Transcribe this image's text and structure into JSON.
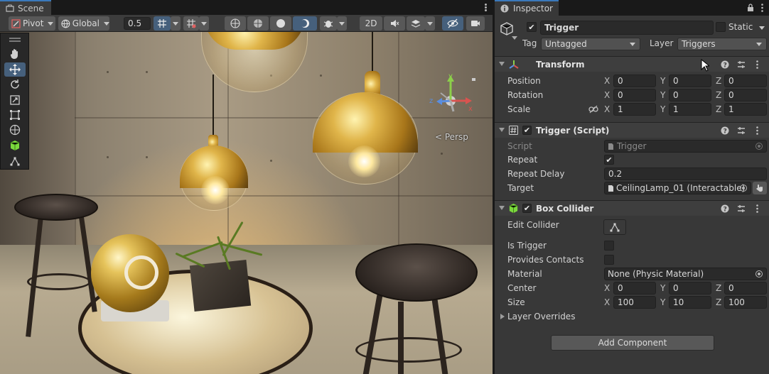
{
  "scene": {
    "tab_label": "Scene",
    "pivot_label": "Pivot",
    "global_label": "Global",
    "snap_value": "0.5",
    "mode_2d_label": "2D",
    "persp_label": "< Persp",
    "gizmo_axes": {
      "x": "x",
      "y": "y",
      "z": "z"
    }
  },
  "inspector": {
    "tab_label": "Inspector",
    "object": {
      "name": "Trigger",
      "active": true,
      "static_label": "Static",
      "static": false,
      "tag_label": "Tag",
      "tag_value": "Untagged",
      "layer_label": "Layer",
      "layer_value": "Triggers"
    },
    "transform": {
      "title": "Transform",
      "position_label": "Position",
      "rotation_label": "Rotation",
      "scale_label": "Scale",
      "position": {
        "x": "0",
        "y": "0",
        "z": "0"
      },
      "rotation": {
        "x": "0",
        "y": "0",
        "z": "0"
      },
      "scale": {
        "x": "1",
        "y": "1",
        "z": "1"
      }
    },
    "trigger_script": {
      "title": "Trigger (Script)",
      "enabled": true,
      "script_label": "Script",
      "script_value": "Trigger",
      "repeat_label": "Repeat",
      "repeat": true,
      "repeat_delay_label": "Repeat Delay",
      "repeat_delay_value": "0.2",
      "target_label": "Target",
      "target_value": "CeilingLamp_01 (Interactable)"
    },
    "box_collider": {
      "title": "Box Collider",
      "enabled": true,
      "edit_collider_label": "Edit Collider",
      "is_trigger_label": "Is Trigger",
      "is_trigger": false,
      "provides_contacts_label": "Provides Contacts",
      "provides_contacts": false,
      "material_label": "Material",
      "material_value": "None (Physic Material)",
      "center_label": "Center",
      "center": {
        "x": "0",
        "y": "0",
        "z": "0"
      },
      "size_label": "Size",
      "size": {
        "x": "100",
        "y": "10",
        "z": "100"
      },
      "layer_overrides_label": "Layer Overrides"
    },
    "add_component_label": "Add Component",
    "axis_labels": {
      "x": "X",
      "y": "Y",
      "z": "Z"
    }
  },
  "colors": {
    "accent_blue": "#3a79bb",
    "active_tool": "#46607c",
    "panel_bg": "#383838",
    "header_bg": "#3e3e3e"
  }
}
